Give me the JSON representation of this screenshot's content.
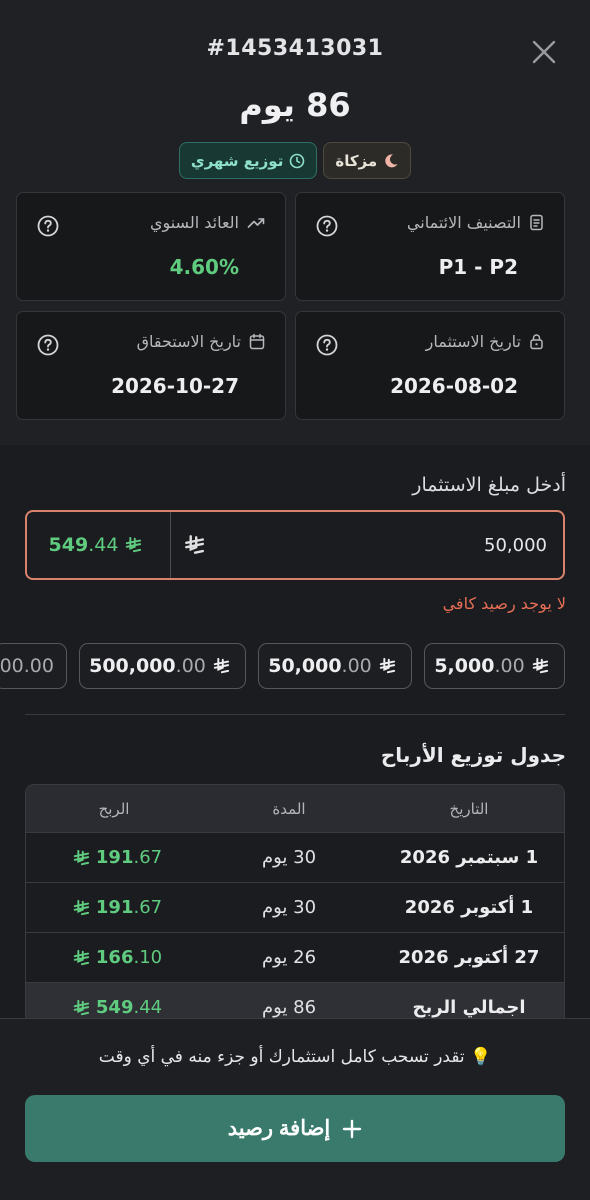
{
  "header": {
    "order_id": "#1453413031",
    "duration": "86 يوم",
    "badges": {
      "halal": "مزكاة",
      "distribution": "توزيع شهري"
    }
  },
  "cards": {
    "annual_return": {
      "label": "العائد السنوي",
      "value": "4.60%"
    },
    "credit_rating": {
      "label": "التصنيف الائتماني",
      "value": "P1 - P2"
    },
    "maturity_date": {
      "label": "تاريخ الاستحقاق",
      "value": "2026-10-27"
    },
    "investment_date": {
      "label": "تاريخ الاستثمار",
      "value": "2026-08-02"
    }
  },
  "investment": {
    "label": "أدخل مبلغ الاستثمار",
    "amount": "50,000",
    "profit_int": "549",
    "profit_dec": ".44",
    "error": "لا يوجد رصيد كافي"
  },
  "quick_amounts": [
    {
      "int": "5,000",
      "dec": ".00"
    },
    {
      "int": "50,000",
      "dec": ".00"
    },
    {
      "int": "500,000",
      "dec": ".00"
    },
    {
      "int": "",
      "dec": "00.00"
    }
  ],
  "schedule": {
    "title": "جدول توزيع الأرباح",
    "headers": {
      "date": "التاريخ",
      "period": "المدة",
      "profit": "الربح"
    },
    "rows": [
      {
        "date": "1 سبتمبر 2026",
        "period": "30 يوم",
        "profit_int": "191",
        "profit_dec": ".67"
      },
      {
        "date": "1 أكتوبر 2026",
        "period": "30 يوم",
        "profit_int": "191",
        "profit_dec": ".67"
      },
      {
        "date": "27 أكتوبر 2026",
        "period": "26 يوم",
        "profit_int": "166",
        "profit_dec": ".10"
      }
    ],
    "total": {
      "label": "اجمالي الربح",
      "period": "86 يوم",
      "profit_int": "549",
      "profit_dec": ".44"
    }
  },
  "footer": {
    "note": "تقدر تسحب كامل استثمارك أو جزء منه في أي وقت",
    "note_icon": "💡",
    "add_button": "إضافة رصيد"
  },
  "colors": {
    "accent": "#397a6d",
    "error": "#e56e55",
    "positive": "#5fcb7f"
  }
}
